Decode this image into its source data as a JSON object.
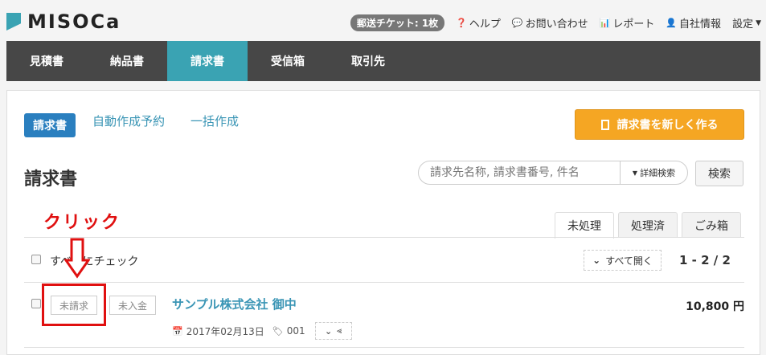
{
  "app": {
    "logo_text": "MISOCa"
  },
  "top_links": {
    "ticket": "郵送チケット: 1枚",
    "help": "ヘルプ",
    "contact": "お問い合わせ",
    "report": "レポート",
    "company": "自社情報",
    "settings": "設定"
  },
  "nav": [
    "見積書",
    "納品書",
    "請求書",
    "受信箱",
    "取引先"
  ],
  "subtabs": {
    "active": "請求書",
    "auto": "自動作成予約",
    "bulk": "一括作成"
  },
  "new_button": "請求書を新しく作る",
  "page_title": "請求書",
  "search": {
    "placeholder": "請求先名称, 請求書番号, 件名",
    "advanced": "詳細検索",
    "button": "検索"
  },
  "annotation": {
    "click": "クリック"
  },
  "status_tabs": [
    "未処理",
    "処理済",
    "ごみ箱"
  ],
  "list": {
    "check_all": "すべてにチェック",
    "expand_all": "すべて開く",
    "count": "1 - 2 / 2",
    "rows": [
      {
        "status1": "未請求",
        "status2": "未入金",
        "client": "サンプル株式会社 御中",
        "amount": "10,800 円",
        "date": "2017年02月13日",
        "number": "001"
      }
    ]
  },
  "colors": {
    "accent": "#3aa3b3",
    "nav_bg": "#474747",
    "orange": "#f5a623",
    "annotation_red": "#e01010"
  }
}
